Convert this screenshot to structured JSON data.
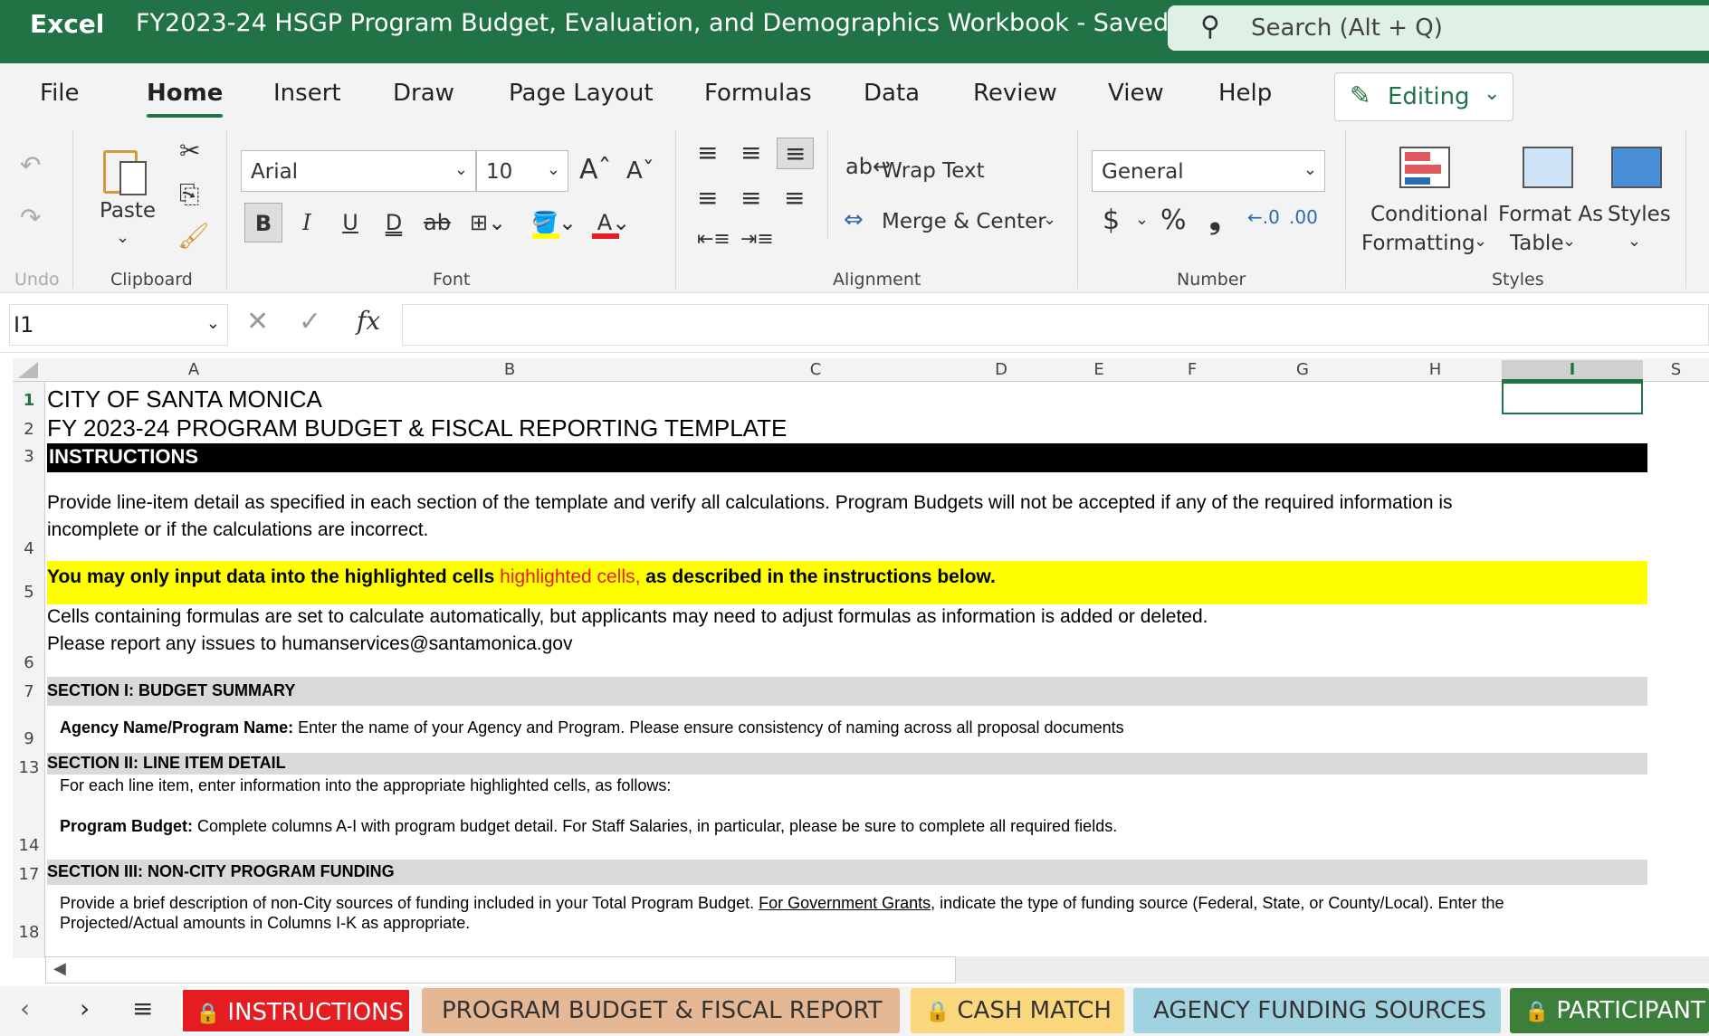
{
  "titlebar": {
    "app_name": "Excel",
    "doc_title": "FY2023-24 HSGP Program Budget, Evaluation, and Demographics Workbook  -  Saved ⌄",
    "search_placeholder": "Search (Alt + Q)"
  },
  "menu": {
    "tabs": [
      "File",
      "Home",
      "Insert",
      "Draw",
      "Page Layout",
      "Formulas",
      "Data",
      "Review",
      "View",
      "Help"
    ],
    "active": "Home",
    "editing_label": "Editing"
  },
  "ribbon": {
    "undo_label": "Undo",
    "clipboard": {
      "paste_label": "Paste",
      "group_label": "Clipboard"
    },
    "font": {
      "family": "Arial",
      "size": "10",
      "group_label": "Font",
      "bold": "B",
      "italic": "I",
      "underline": "U",
      "double_underline": "D",
      "strike": "ab"
    },
    "alignment": {
      "wrap_text": "Wrap Text",
      "merge_center": "Merge & Center",
      "group_label": "Alignment"
    },
    "number": {
      "format": "General",
      "currency": "$",
      "percent": "%",
      "comma": "❟",
      "group_label": "Number"
    },
    "styles": {
      "conditional_1": "Conditional",
      "conditional_2": "Formatting",
      "format_as_1": "Format As",
      "format_as_2": "Table",
      "styles_label": "Styles",
      "group_label": "Styles"
    }
  },
  "formula_bar": {
    "name_box": "I1",
    "fx": "fx",
    "value": ""
  },
  "columns": [
    "A",
    "B",
    "C",
    "D",
    "E",
    "F",
    "G",
    "H",
    "I",
    "S"
  ],
  "rows": {
    "r1": {
      "num": "1",
      "text": "CITY OF SANTA MONICA"
    },
    "r2": {
      "num": "2",
      "text": "FY 2023-24 PROGRAM BUDGET & FISCAL REPORTING TEMPLATE"
    },
    "r3": {
      "num": "3",
      "text": "INSTRUCTIONS"
    },
    "r4": {
      "num": "4",
      "line1": "Provide line-item detail as specified in each section of the template and verify all calculations. Program Budgets will not be accepted if any of the required information is",
      "line2": "incomplete or if the calculations are incorrect."
    },
    "r5": {
      "num": "5",
      "text_a": "You may only input data into the highlighted cells ",
      "text_red": "highlighted cells,",
      "text_b": " as described in the instructions below."
    },
    "r6": {
      "num": "6",
      "line1": "Cells containing formulas are set to calculate automatically, but applicants may need to adjust formulas as information is added or deleted.",
      "line2": "Please report any issues to humanservices@santamonica.gov"
    },
    "r7": {
      "num": "7",
      "text": "SECTION I: BUDGET SUMMARY"
    },
    "r9": {
      "num": "9",
      "bold": "Agency Name/Program Name:",
      "text": " Enter the name of your Agency and Program. Please ensure consistency of naming across all proposal documents"
    },
    "r13": {
      "num": "13",
      "text": "SECTION II: LINE ITEM DETAIL"
    },
    "r14": {
      "num": "14",
      "line1": "For each line item, enter information into the appropriate highlighted cells, as follows:",
      "bold": "Program Budget:",
      "line2": " Complete columns A-I with program budget detail. For Staff Salaries, in particular, please be sure to complete all required fields."
    },
    "r17": {
      "num": "17",
      "text": "SECTION III: NON-CITY PROGRAM FUNDING"
    },
    "r18": {
      "num": "18",
      "line1a": "Provide a brief description of non-City sources of funding included in your Total Program Budget. ",
      "line1u": "For Government Grants",
      "line1b": ", indicate the type of funding source (Federal, State, or County/Local). Enter the",
      "line2": "Projected/Actual amounts in Columns I-K as appropriate."
    }
  },
  "sheet_tabs": [
    {
      "label": "INSTRUCTIONS",
      "color": "#e41d23",
      "locked": true
    },
    {
      "label": "PROGRAM BUDGET & FISCAL REPORT",
      "color": "#e6b794",
      "locked": false
    },
    {
      "label": "CASH MATCH",
      "color": "#fad67d",
      "locked": true
    },
    {
      "label": "AGENCY FUNDING SOURCES",
      "color": "#9fd1df",
      "locked": false
    },
    {
      "label": "PARTICIPANT",
      "color": "#3b7f3a",
      "locked": true
    }
  ],
  "colors": {
    "brand": "#217346",
    "highlight_yellow": "#ffff00",
    "section_gray": "#d9d9d9"
  }
}
